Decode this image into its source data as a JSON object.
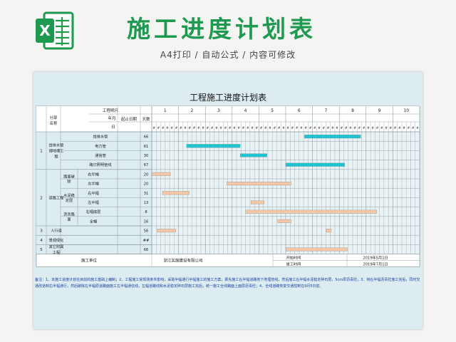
{
  "header": {
    "title": "施工进度计划表",
    "subtitle": "A4打印 / 自动公式 / 内容可修改",
    "logo_letter": "X"
  },
  "sheet": {
    "title": "工程施工进度计划表",
    "col_headers": {
      "division": "分部名称",
      "item_header": "工程明尺",
      "year_month": "年月",
      "day": "日",
      "start_date": "起止日期",
      "days": "天数"
    },
    "months": [
      "1",
      "2",
      "3",
      "4",
      "5",
      "6",
      "7",
      "8",
      "9",
      "10"
    ],
    "sub_day_marker": "#",
    "groups": [
      {
        "no": "1",
        "name": "给排水管理地埋工程"
      },
      {
        "no": "2",
        "name": "道路工程"
      },
      {
        "no": "3",
        "name": "人行道"
      },
      {
        "no": "4",
        "name": "景观绿化"
      },
      {
        "no": "5",
        "name": "其它附属工程"
      }
    ],
    "subgroups": [
      {
        "name": "路面破除"
      },
      {
        "name": "水泥稳定层"
      },
      {
        "name": "沥青路面"
      }
    ],
    "rows": [
      {
        "item": "给排水管",
        "days": "66"
      },
      {
        "item": "电力管",
        "days": "61"
      },
      {
        "item": "通信管",
        "days": "30"
      },
      {
        "item": "路灯照明管线",
        "days": "67"
      },
      {
        "item": "右半幅",
        "days": "20"
      },
      {
        "item": "左半幅",
        "days": "20"
      },
      {
        "item": "右半幅",
        "days": "31"
      },
      {
        "item": "左半幅",
        "days": "13"
      },
      {
        "item": "右幅底层",
        "days": "8"
      },
      {
        "item": "全幅",
        "days": "16"
      },
      {
        "item": "",
        "days": "56"
      },
      {
        "item": "",
        "days": "##"
      },
      {
        "item": "",
        "days": "66"
      }
    ],
    "footer": {
      "unit_label": "施工单位",
      "unit_value": "浙江实施建设有限公司",
      "start_label": "开始时间",
      "start_value": "2019年5月1日",
      "end_label": "竣工时间",
      "end_value": "2019年7月1日"
    },
    "notes": "备注：1、本施工进度计划在目前的施工基础上编制；2、工程施工受现场条件影响，采取半幅通行半幅施工的施工方案，即先施工右半幅道路地下地埋管线，然后施工右半幅水泥稳定碎石层，5cm厚沥青砼，3、待右半幅沥青砼施工完后，同时交通改道到右半幅通行，然后破除左半幅原道路面施工左半幅通信线，左幅道路线和水泥稳定碎石层施工完后，统一施工全线路面上面层沥青砼；4、全线道路恢复交通控制在9月5日前。"
  },
  "chart_data": {
    "type": "gantt",
    "time_unit": "months 1-10 subdivided into 6 periods",
    "bars": [
      {
        "row": 0,
        "start": 6.7,
        "end": 8.8,
        "color": "#1fc4d0"
      },
      {
        "row": 1,
        "start": 2.3,
        "end": 4.3,
        "color": "#1fc4d0"
      },
      {
        "row": 2,
        "start": 4.3,
        "end": 5.3,
        "color": "#1fc4d0"
      },
      {
        "row": 3,
        "start": 6.0,
        "end": 8.2,
        "color": "#1fc4d0"
      },
      {
        "row": 4,
        "start": 1.0,
        "end": 1.7,
        "color": "#f2c6a6"
      },
      {
        "row": 5,
        "start": 3.8,
        "end": 6.2,
        "color": "#f2c6a6"
      },
      {
        "row": 6,
        "start": 1.4,
        "end": 2.4,
        "color": "#f2c6a6"
      },
      {
        "row": 7,
        "start": 4.7,
        "end": 5.2,
        "color": "#f2c6a6"
      },
      {
        "row": 8,
        "start": 4.5,
        "end": 9.4,
        "color": "#f2c6a6"
      },
      {
        "row": 9,
        "start": 5.7,
        "end": 6.2,
        "color": "#f2c6a6"
      },
      {
        "row": 10,
        "start": 1.2,
        "end": 1.9,
        "color": "#f2c6a6"
      },
      {
        "row": 10,
        "start": 7.5,
        "end": 7.7,
        "color": "#f2c6a6"
      },
      {
        "row": 12,
        "start": 6.0,
        "end": 8.3,
        "color": "#f2c6a6"
      }
    ],
    "grid": true
  }
}
